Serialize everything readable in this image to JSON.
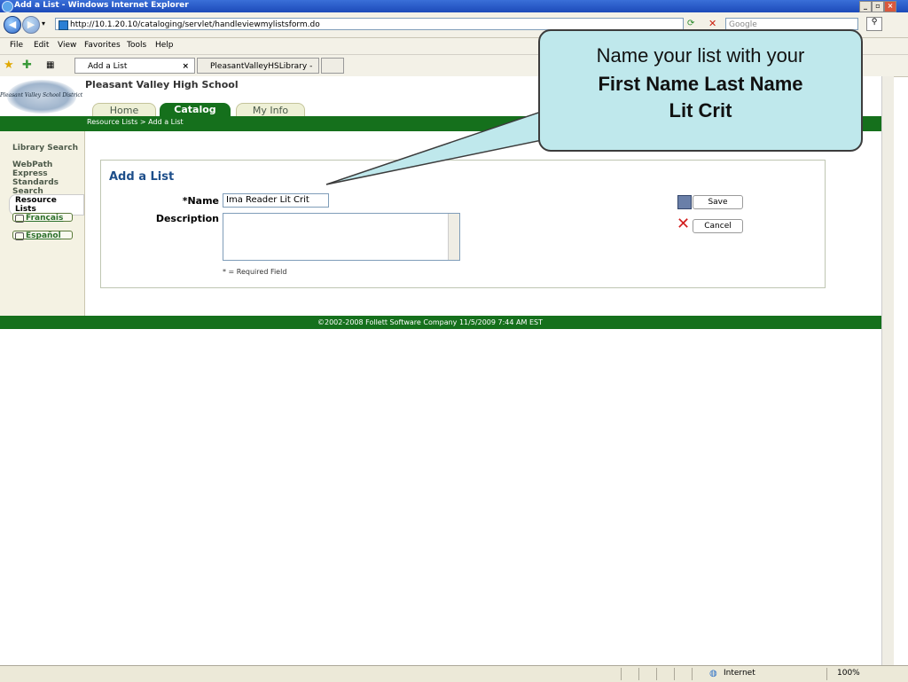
{
  "window": {
    "title": "Add a List - Windows Internet Explorer"
  },
  "browser": {
    "url": "http://10.1.20.10/cataloging/servlet/handleviewmylistsform.do",
    "search_placeholder": "Google",
    "menu": [
      "File",
      "Edit",
      "View",
      "Favorites",
      "Tools",
      "Help"
    ],
    "tabs": [
      "Add a List",
      "PleasantValleyHSLibrary - Lit..."
    ],
    "status": {
      "zone": "Internet",
      "zoom": "100%"
    }
  },
  "site": {
    "school_name": "Pleasant Valley High School",
    "logo_text": "Pleasant Valley School District",
    "nav_tabs": [
      "Home",
      "Catalog",
      "My Info"
    ],
    "active_tab": "Catalog",
    "breadcrumb": "Resource Lists > Add a List"
  },
  "sidebar": {
    "items": [
      "Library Search",
      "WebPath Express",
      "Standards Search",
      "Resource Lists"
    ],
    "active": "Resource Lists",
    "languages": [
      "Français",
      "Español"
    ]
  },
  "form": {
    "title": "Add a List",
    "name_label": "*Name",
    "name_value": "Ima Reader Lit Crit",
    "description_label": "Description",
    "description_value": "",
    "required_note": "* = Required Field",
    "save_label": "Save",
    "cancel_label": "Cancel"
  },
  "footer": {
    "text": "©2002-2008  Follett Software Company    11/5/2009 7:44 AM EST"
  },
  "callout": {
    "line1": "Name your list with your",
    "line2": "First Name Last Name",
    "line3": "Lit Crit",
    "bg_color": "#bfe8ec"
  },
  "colors": {
    "brand_green": "#15701c",
    "title_blue": "#1d4e8a"
  }
}
